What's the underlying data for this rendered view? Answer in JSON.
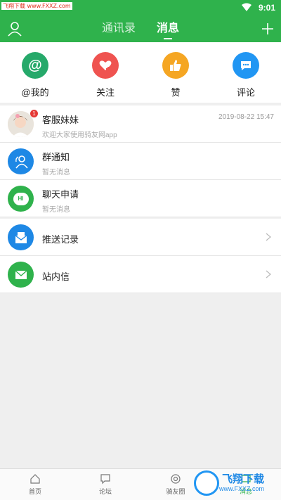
{
  "status_bar": {
    "watermark": "飞翔下载 www.FXXZ.com",
    "time": "9:01"
  },
  "header": {
    "tabs": [
      "通讯录",
      "消息"
    ],
    "active_tab": "消息"
  },
  "quick_actions": [
    {
      "label": "@我的",
      "icon": "at-icon",
      "color": "#26a96a"
    },
    {
      "label": "关注",
      "icon": "heart-plus-icon",
      "color": "#ef5350"
    },
    {
      "label": "赞",
      "icon": "thumbs-up-icon",
      "color": "#f5a623"
    },
    {
      "label": "评论",
      "icon": "comment-icon",
      "color": "#2196f3"
    }
  ],
  "messages": [
    {
      "title": "客服妹妹",
      "subtitle": "欢迎大家使用骑友网app",
      "time": "2019-08-22 15:47",
      "badge": "1"
    },
    {
      "title": "群通知",
      "subtitle": "暂无消息"
    },
    {
      "title": "聊天申请",
      "subtitle": "暂无消息",
      "icon_text": "HI"
    }
  ],
  "links": [
    {
      "title": "推送记录"
    },
    {
      "title": "站内信"
    }
  ],
  "tabbar": [
    {
      "label": "首页"
    },
    {
      "label": "论坛"
    },
    {
      "label": "骑友圈"
    },
    {
      "label": "消息"
    }
  ],
  "watermark": {
    "text": "飞翔下载",
    "url": "www.FXXZ.com"
  },
  "colors": {
    "brand": "#2fb24c",
    "blue": "#1e88e5"
  }
}
